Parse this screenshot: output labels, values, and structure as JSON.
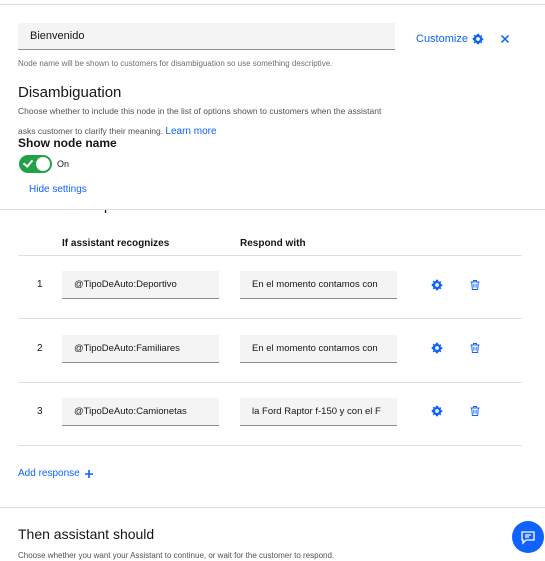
{
  "node": {
    "name_value": "Bienvenido",
    "helper_text": "Node name will be shown to customers for disambiguation so use something descriptive.",
    "customize_label": "Customize"
  },
  "disambiguation": {
    "title": "Disambiguation",
    "description": "Choose whether to include this node in the list of options shown to customers when the assistant asks customer to clarify their meaning.",
    "learn_more": "Learn more",
    "show_node_name_label": "Show node name",
    "toggle_state": "On",
    "hide_settings": "Hide settings"
  },
  "responses": {
    "section_title": "Assistant responds",
    "col_condition": "If assistant recognizes",
    "col_response": "Respond with",
    "rows": [
      {
        "num": "1",
        "condition": "@TipoDeAuto:Deportivo",
        "response": "En el momento contamos con"
      },
      {
        "num": "2",
        "condition": "@TipoDeAuto:Familiares",
        "response": "En el momento contamos con"
      },
      {
        "num": "3",
        "condition": "@TipoDeAuto:Camionetas",
        "response": "la Ford Raptor f-150 y con el F"
      }
    ],
    "add_response": "Add response"
  },
  "then": {
    "title": "Then assistant should",
    "description": "Choose whether you want your Assistant to continue, or wait for the customer to respond."
  },
  "colors": {
    "accent": "#0f62fe",
    "toggle_on": "#24a148"
  },
  "icons": [
    "gear-icon",
    "close-icon",
    "trash-icon",
    "plus-icon",
    "chat-icon"
  ]
}
